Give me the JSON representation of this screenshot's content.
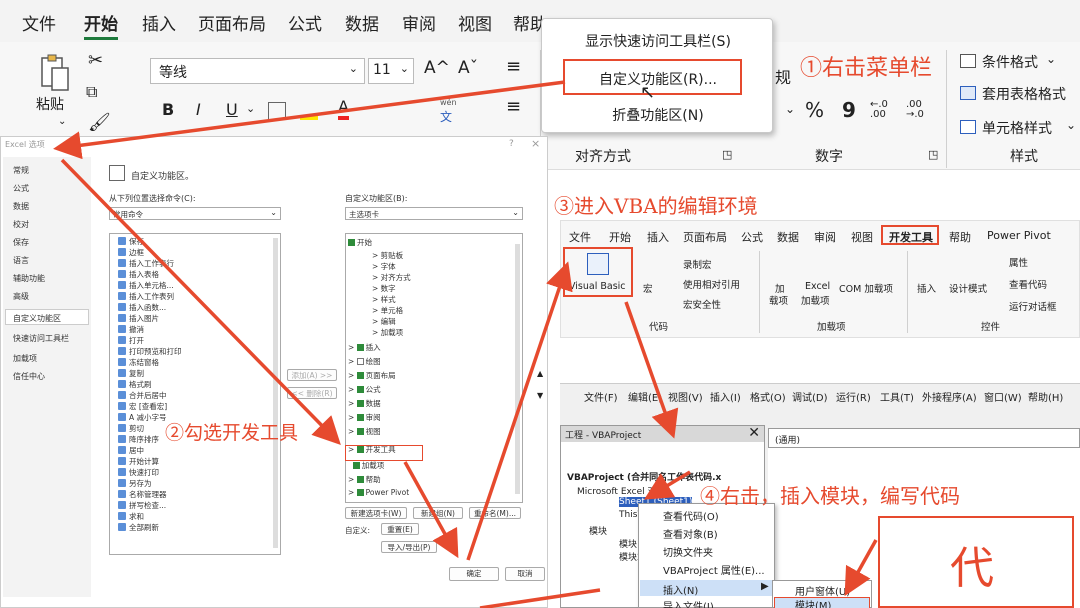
{
  "ribbon": {
    "tabs": [
      "文件",
      "开始",
      "插入",
      "页面布局",
      "公式",
      "数据",
      "审阅",
      "视图",
      "帮助",
      "Power Pivot"
    ],
    "active_tab": "开始",
    "paste_label": "粘贴",
    "font_name": "等线",
    "font_size": "11",
    "grow_font": "A^",
    "shrink_font": "Aˇ",
    "bold": "B",
    "italic": "I",
    "underline": "U",
    "wen": "wén",
    "wen2": "文",
    "align_group": "对齐方式",
    "number_group": "数字",
    "number_fmt_partial": "规",
    "percent": "%",
    "comma": "9",
    "dec_inc": "←.0 .00",
    "dec_dec": ".00 →.0",
    "style_group": "样式",
    "cond_format": "条件格式",
    "table_format": "套用表格格式",
    "cell_style": "单元格样式",
    "accent": "#e64a2e"
  },
  "context_menu": {
    "items": [
      "显示快速访问工具栏(S)",
      "自定义功能区(R)...",
      "折叠功能区(N)"
    ]
  },
  "options_dialog": {
    "title": "Excel 选项",
    "help": "?",
    "close": "×",
    "nav": [
      "常规",
      "公式",
      "数据",
      "校对",
      "保存",
      "语言",
      "辅助功能",
      "高级",
      "自定义功能区",
      "快速访问工具栏",
      "加载项",
      "信任中心"
    ],
    "header": "自定义功能区。",
    "choose_label": "从下列位置选择命令(C):",
    "choose_value": "常用命令",
    "customize_label": "自定义功能区(B):",
    "customize_value": "主选项卡",
    "commands": [
      "保存",
      "边框",
      "插入工作表行",
      "插入表格",
      "插入单元格...",
      "插入工作表列",
      "插入函数...",
      "插入图片",
      "撤消",
      "打开",
      "打印预览和打印",
      "冻结窗格",
      "复制",
      "格式刷",
      "合并后居中",
      "宏 [查看宏]",
      "A 减小字号",
      "剪切",
      "降序排序",
      "居中",
      "开始计算",
      "快速打印",
      "另存为",
      "名称管理器",
      "拼写检查...",
      "求和",
      "全部刷新"
    ],
    "tree": {
      "home": "开始",
      "home_children": [
        "剪贴板",
        "字体",
        "对齐方式",
        "数字",
        "样式",
        "单元格",
        "编辑",
        "加载项"
      ],
      "others": [
        "插入",
        "绘图",
        "页面布局",
        "公式",
        "数据",
        "审阅",
        "视图",
        "开发工具",
        "加载项",
        "帮助",
        "Power Pivot"
      ]
    },
    "add_btn": "添加(A) >>",
    "remove_btn": "<< 删除(R)",
    "new_tab_btn": "新建选项卡(W)",
    "new_group_btn": "新建组(N)",
    "rename_btn": "重命名(M)...",
    "customize_row_label": "自定义:",
    "reset_btn": "重置(E)",
    "import_export_btn": "导入/导出(P)",
    "ok_btn": "确定",
    "cancel_btn": "取消"
  },
  "dev_ribbon": {
    "tabs": [
      "文件",
      "开始",
      "插入",
      "页面布局",
      "公式",
      "数据",
      "审阅",
      "视图",
      "开发工具",
      "帮助",
      "Power Pivot"
    ],
    "active_tab": "开发工具",
    "visual_basic": "Visual Basic",
    "macro": "宏",
    "record_macro": "录制宏",
    "relative_ref": "使用相对引用",
    "macro_security": "宏安全性",
    "code_group": "代码",
    "addins": "加载项",
    "addins2": "加",
    "addins3": "载项",
    "excel_addins": "Excel",
    "excel_addins2": "加载项",
    "com_addins": "COM 加载项",
    "addins_group": "加载项",
    "insert": "插入",
    "design_mode": "设计模式",
    "properties": "属性",
    "view_code": "查看代码",
    "run_dialog": "运行对话框",
    "controls_group": "控件"
  },
  "vba": {
    "menu": [
      "文件(F)",
      "编辑(E)",
      "视图(V)",
      "插入(I)",
      "格式(O)",
      "调试(D)",
      "运行(R)",
      "工具(T)",
      "外接程序(A)",
      "窗口(W)",
      "帮助(H)"
    ],
    "project_title": "工程 - VBAProject",
    "general": "(通用)",
    "tree": [
      "VBAProject (合并同名工作表代码.x",
      "Microsoft Excel 对象",
      "Sheet1 (Sheet1)",
      "ThisWorkbook",
      "模块",
      "模块1",
      "模块2"
    ],
    "context_items": [
      "查看代码(O)",
      "查看对象(B)",
      "切换文件夹",
      "VBAProject 属性(E)...",
      "插入(N)",
      "导入文件(I)..."
    ],
    "submenu": [
      "用户窗体(U)",
      "模块(M)"
    ]
  },
  "annotations": {
    "step1": "①右击菜单栏",
    "step2": "②勾选开发工具",
    "step3": "③进入VBA的编辑环境",
    "step4": "④右击，插入模块，编写代码",
    "code_big": "代",
    "code_big2": "码"
  }
}
